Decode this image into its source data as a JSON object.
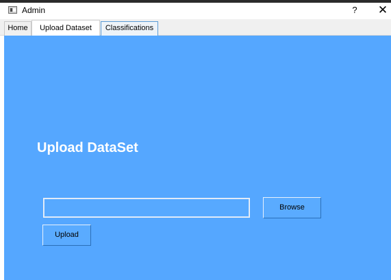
{
  "window": {
    "title": "Admin",
    "help_label": "?",
    "close_label": "✕"
  },
  "tabs": [
    {
      "label": "Home"
    },
    {
      "label": "Upload Dataset",
      "active": true
    },
    {
      "label": "Classifications"
    }
  ],
  "main": {
    "heading": "Upload DataSet",
    "file_path_value": "",
    "browse_label": "Browse",
    "upload_label": "Upload"
  },
  "colors": {
    "panel_background": "#55a7ff",
    "heading_text": "#ffffff",
    "tab_focus_border": "#5a9bd5"
  }
}
